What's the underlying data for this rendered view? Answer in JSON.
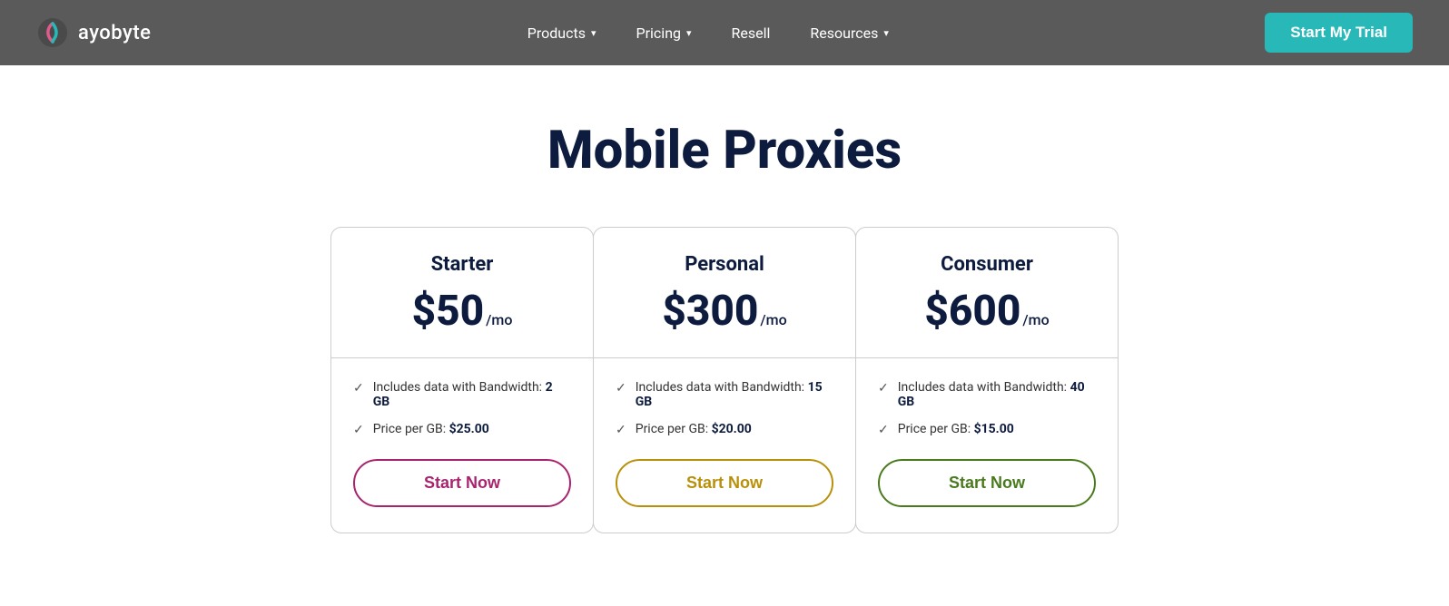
{
  "navbar": {
    "logo_text": "ayobyte",
    "nav_items": [
      {
        "label": "Products",
        "has_dropdown": true
      },
      {
        "label": "Pricing",
        "has_dropdown": true
      },
      {
        "label": "Resell",
        "has_dropdown": false
      },
      {
        "label": "Resources",
        "has_dropdown": true
      }
    ],
    "cta_label": "Start My Trial"
  },
  "page": {
    "title": "Mobile Proxies"
  },
  "plans": [
    {
      "id": "starter",
      "name": "Starter",
      "price": "$50",
      "period": "/mo",
      "bandwidth_label": "Includes data with Bandwidth:",
      "bandwidth_value": "2 GB",
      "price_per_gb_label": "Price per GB:",
      "price_per_gb_value": "$25.00",
      "cta": "Start Now",
      "btn_class": "start-btn-starter"
    },
    {
      "id": "personal",
      "name": "Personal",
      "price": "$300",
      "period": "/mo",
      "bandwidth_label": "Includes data with Bandwidth:",
      "bandwidth_value": "15 GB",
      "price_per_gb_label": "Price per GB:",
      "price_per_gb_value": "$20.00",
      "cta": "Start Now",
      "btn_class": "start-btn-personal"
    },
    {
      "id": "consumer",
      "name": "Consumer",
      "price": "$600",
      "period": "/mo",
      "bandwidth_label": "Includes data with Bandwidth:",
      "bandwidth_value": "40 GB",
      "price_per_gb_label": "Price per GB:",
      "price_per_gb_value": "$15.00",
      "cta": "Start Now",
      "btn_class": "start-btn-consumer"
    }
  ]
}
